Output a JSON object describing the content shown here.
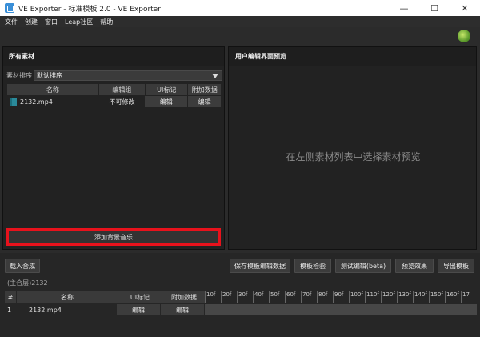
{
  "window": {
    "title": "VE Exporter - 标准模板 2.0 - VE Exporter",
    "minimize": "—",
    "maximize": "☐",
    "close": "✕"
  },
  "menu": [
    "文件",
    "创建",
    "窗口",
    "Leap社区",
    "帮助"
  ],
  "left_panel": {
    "title": "所有素材",
    "sort_label": "素材排序",
    "sort_value": "默认排序",
    "columns": [
      "名称",
      "编辑组",
      "UI标记",
      "附加数据"
    ],
    "rows": [
      {
        "name": "2132.mp4",
        "group": "不可修改",
        "ui": "编辑",
        "extra": "编辑"
      }
    ],
    "add_music": "添加背景音乐"
  },
  "right_panel": {
    "title": "用户编辑界面预览",
    "hint": "在左侧素材列表中选择素材预览"
  },
  "bottom": {
    "load_comp": "载入合成",
    "save_edit_data": "保存模板编辑数据",
    "check_template": "模板检验",
    "test_edit": "测试编辑(beta)",
    "preview_effect": "预览效果",
    "export_template": "导出模板",
    "layer_label": "(主合层)2132",
    "columns": [
      "#",
      "名称",
      "UI标记",
      "附加数据"
    ],
    "rows": [
      {
        "num": "1",
        "name": "2132.mp4",
        "ui": "编辑",
        "extra": "编辑"
      }
    ],
    "ticks": [
      "10f",
      "20f",
      "30f",
      "40f",
      "50f",
      "60f",
      "70f",
      "80f",
      "90f",
      "100f",
      "110f",
      "120f",
      "130f",
      "140f",
      "150f",
      "160f",
      "17"
    ]
  }
}
